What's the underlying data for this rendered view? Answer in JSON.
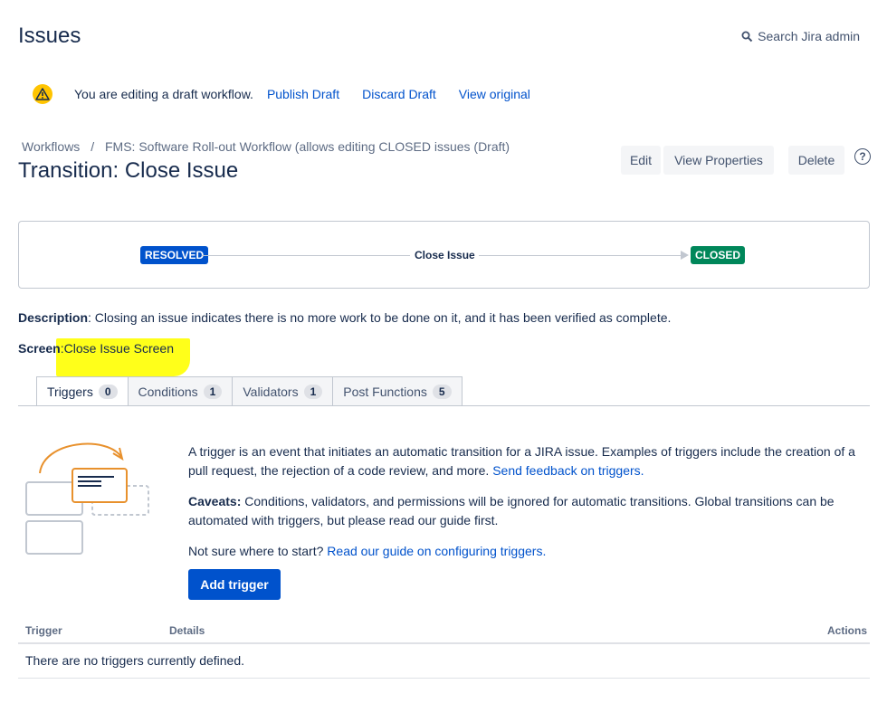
{
  "header": {
    "title": "Issues",
    "search_label": "Search Jira admin"
  },
  "draft_notice": {
    "message": "You are editing a draft workflow.",
    "publish": "Publish Draft",
    "discard": "Discard Draft",
    "view_original": "View original"
  },
  "breadcrumb": {
    "items": [
      "Workflows",
      "FMS: Software Roll-out Workflow (allows editing CLOSED issues (Draft)"
    ],
    "separator": "/"
  },
  "transition": {
    "title": "Transition: Close Issue"
  },
  "toolbar": {
    "edit": "Edit",
    "view_properties": "View Properties",
    "delete": "Delete",
    "help": "?"
  },
  "diagram": {
    "from_status": "RESOLVED",
    "transition_name": "Close Issue",
    "to_status": "CLOSED",
    "colors": {
      "resolved": "#0052cc",
      "closed": "#00875a"
    }
  },
  "details": {
    "description_label": "Description",
    "description_value": ": Closing an issue indicates there is no more work to be done on it, and it has been verified as complete.",
    "screen_label": "Screen",
    "screen_colon": ":",
    "screen_value": "Close Issue Screen",
    "highlight_color": "#ffff1a"
  },
  "tabs": [
    {
      "label": "Triggers",
      "count": "0",
      "active": true
    },
    {
      "label": "Conditions",
      "count": "1"
    },
    {
      "label": "Validators",
      "count": "1"
    },
    {
      "label": "Post Functions",
      "count": "5"
    }
  ],
  "triggers": {
    "intro": "A trigger is an event that initiates an automatic transition for a JIRA issue. Examples of triggers include the creation of a pull request, the rejection of a code review, and more.",
    "feedback_link": "Send feedback on triggers.",
    "caveats_label": "Caveats:",
    "caveats_text": " Conditions, validators, and permissions will be ignored for automatic transitions. Global transitions can be automated with triggers, but please read our guide first.",
    "start_text": "Not sure where to start?",
    "guide_link": "Read our guide on configuring triggers.",
    "add_button": "Add trigger"
  },
  "table": {
    "columns": [
      "Trigger",
      "Details",
      "Actions"
    ],
    "empty_message": "There are no triggers currently defined."
  }
}
